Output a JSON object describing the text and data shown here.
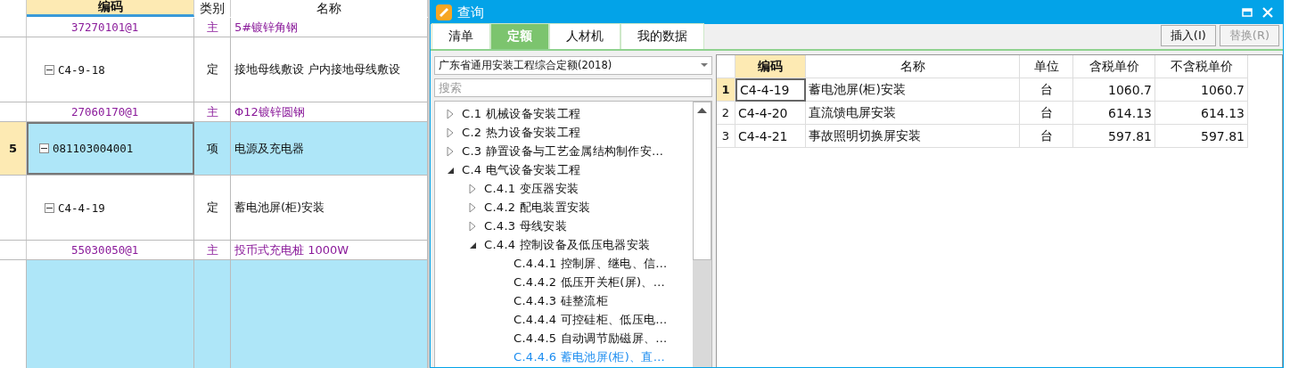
{
  "grid": {
    "columns": [
      {
        "label": "编码",
        "active": true
      },
      {
        "label": "类别",
        "active": false
      },
      {
        "label": "名称",
        "active": false
      }
    ],
    "rows": [
      {
        "kind": "material",
        "code": "37270101@1",
        "type": "主",
        "name": "5#镀锌角钢",
        "selected": false
      },
      {
        "kind": "quota",
        "code": "C4-9-18",
        "type": "定",
        "name": "接地母线敷设 户内接地母线敷设",
        "expanded": true,
        "selected": false
      },
      {
        "kind": "material",
        "code": "27060170@1",
        "type": "主",
        "name": "Φ12镀锌圆钢",
        "selected": false
      },
      {
        "kind": "item",
        "number": "5",
        "code": "081103004001",
        "type": "项",
        "name": "电源及充电器",
        "expanded": true,
        "selected": true
      },
      {
        "kind": "quota",
        "code": "C4-4-19",
        "type": "定",
        "name": "蓄电池屏(柜)安装",
        "expanded": true,
        "selected": false
      },
      {
        "kind": "material",
        "code": "55030050@1",
        "type": "主",
        "name": "投币式充电桩 1000W",
        "selected": false
      }
    ]
  },
  "dialog": {
    "title": "查询",
    "tabs": [
      {
        "label": "清单",
        "selected": false
      },
      {
        "label": "定额",
        "selected": true
      },
      {
        "label": "人材机",
        "selected": false
      },
      {
        "label": "我的数据",
        "selected": false
      }
    ],
    "buttons": [
      {
        "label": "插入(I)",
        "disabled": false
      },
      {
        "label": "替换(R)",
        "disabled": true
      }
    ],
    "library": {
      "value": "广东省通用安装工程综合定额(2018)"
    },
    "search": {
      "placeholder": "搜索"
    },
    "tree": [
      {
        "label": "C.1  机械设备安装工程",
        "expanded": false
      },
      {
        "label": "C.2  热力设备安装工程",
        "expanded": false
      },
      {
        "label": "C.3  静置设备与工艺金属结构制作安…",
        "expanded": false
      },
      {
        "label": "C.4  电气设备安装工程",
        "expanded": true,
        "children": [
          {
            "label": "C.4.1  变压器安装",
            "expanded": false
          },
          {
            "label": "C.4.2  配电装置安装",
            "expanded": false
          },
          {
            "label": "C.4.3  母线安装",
            "expanded": false
          },
          {
            "label": "C.4.4  控制设备及低压电器安装",
            "expanded": true,
            "children": [
              {
                "label": "C.4.4.1  控制屏、继电、信…",
                "selected": false
              },
              {
                "label": "C.4.4.2  低压开关柜(屏)、…",
                "selected": false
              },
              {
                "label": "C.4.4.3  硅整流柜",
                "selected": false
              },
              {
                "label": "C.4.4.4  可控硅柜、低压电…",
                "selected": false
              },
              {
                "label": "C.4.4.5  自动调节励磁屏、…",
                "selected": false
              },
              {
                "label": "C.4.4.6  蓄电池屏(柜)、直…",
                "selected": true
              }
            ]
          }
        ]
      }
    ],
    "table": {
      "columns": [
        {
          "label": "编码",
          "active": true
        },
        {
          "label": "名称",
          "active": false
        },
        {
          "label": "单位",
          "active": false
        },
        {
          "label": "含税单价",
          "active": false
        },
        {
          "label": "不含税单价",
          "active": false
        }
      ],
      "rows": [
        {
          "number": "1",
          "selected": true,
          "cells": [
            "C4-4-19",
            "蓄电池屏(柜)安装",
            "台",
            "1060.7",
            "1060.7"
          ]
        },
        {
          "number": "2",
          "selected": false,
          "cells": [
            "C4-4-20",
            "直流馈电屏安装",
            "台",
            "614.13",
            "614.13"
          ]
        },
        {
          "number": "3",
          "selected": false,
          "cells": [
            "C4-4-21",
            "事故照明切换屏安装",
            "台",
            "597.81",
            "597.81"
          ]
        }
      ]
    }
  }
}
